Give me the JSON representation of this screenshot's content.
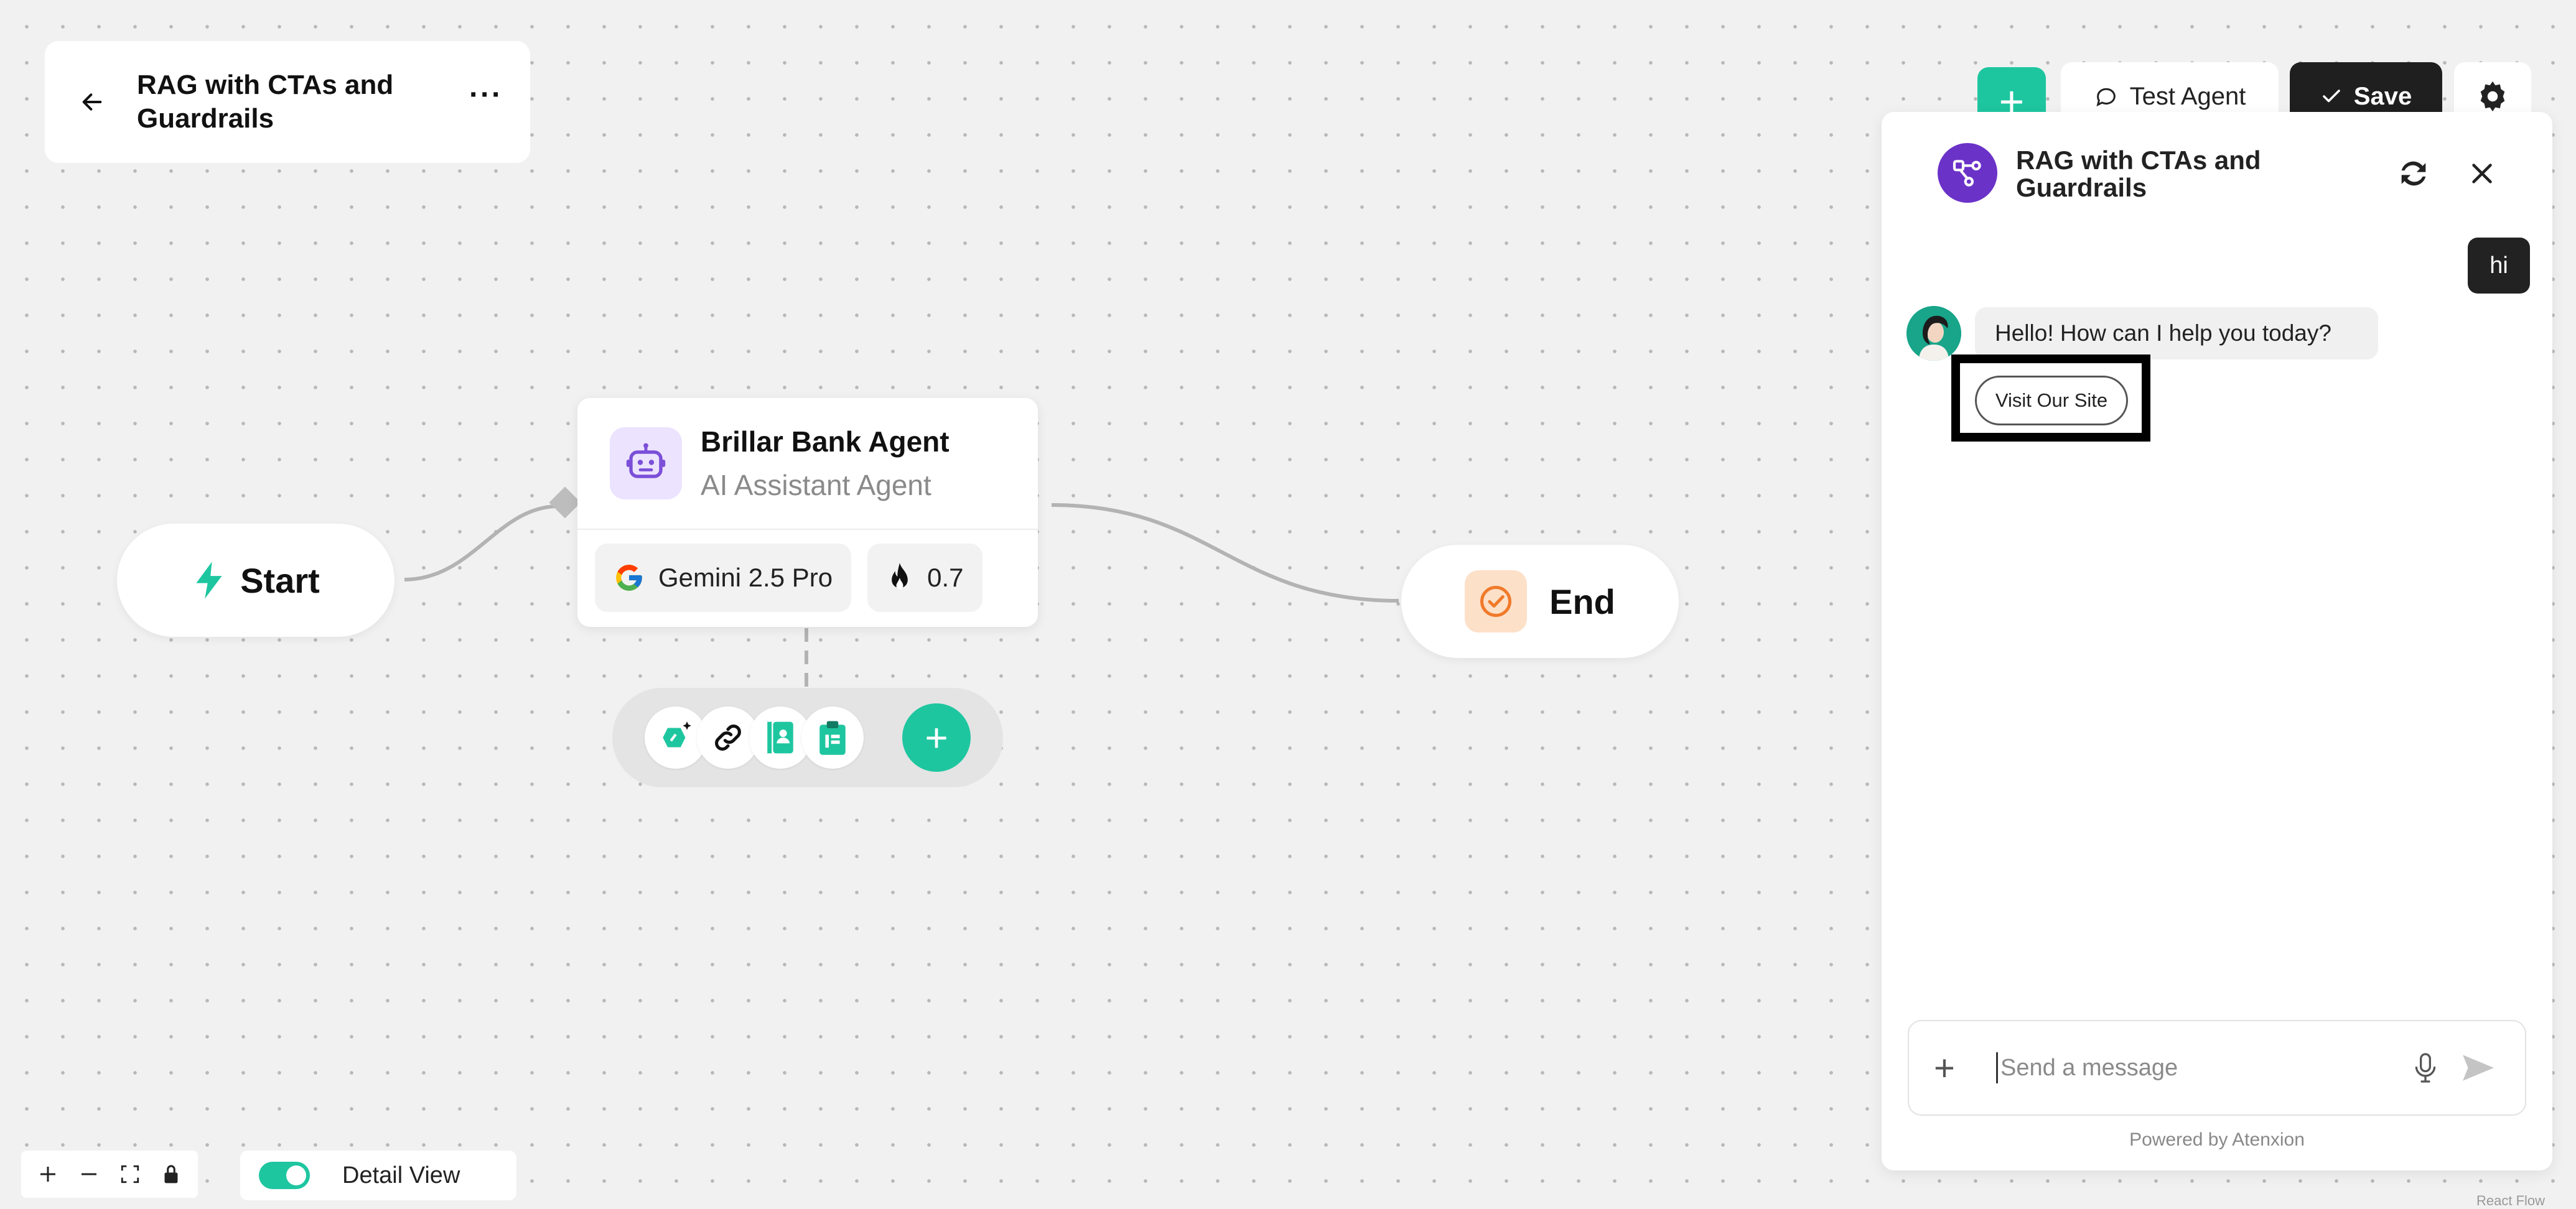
{
  "workflow": {
    "title": "RAG with CTAs and Guardrails"
  },
  "toolbar": {
    "add_label": "+",
    "test_label": "Test Agent",
    "save_label": "Save"
  },
  "nodes": {
    "start": {
      "label": "Start"
    },
    "agent": {
      "name": "Brillar Bank Agent",
      "subtitle": "AI Assistant Agent",
      "model": "Gemini 2.5 Pro",
      "temperature": "0.7"
    },
    "end": {
      "label": "End"
    }
  },
  "controls": {
    "detail_view_label": "Detail View",
    "detail_view_on": true
  },
  "chat": {
    "title": "RAG with CTAs and Guardrails",
    "messages": [
      {
        "role": "user",
        "text": "hi"
      },
      {
        "role": "bot",
        "text": "Hello! How can I help you today?"
      }
    ],
    "cta_label": "Visit Our Site",
    "input_placeholder": "Send a message",
    "attach_label": "+",
    "powered_by": "Powered by Atenxion"
  },
  "footer": {
    "attribution": "React Flow"
  },
  "colors": {
    "accent": "#1ec6a0",
    "chat_avatar": "#6b32c8",
    "save_bg": "#1f1f1f",
    "end_icon_bg": "#fde0c8",
    "end_icon": "#f07a2a",
    "agent_icon_bg": "#ece3ff",
    "agent_icon": "#7b4fd8"
  }
}
